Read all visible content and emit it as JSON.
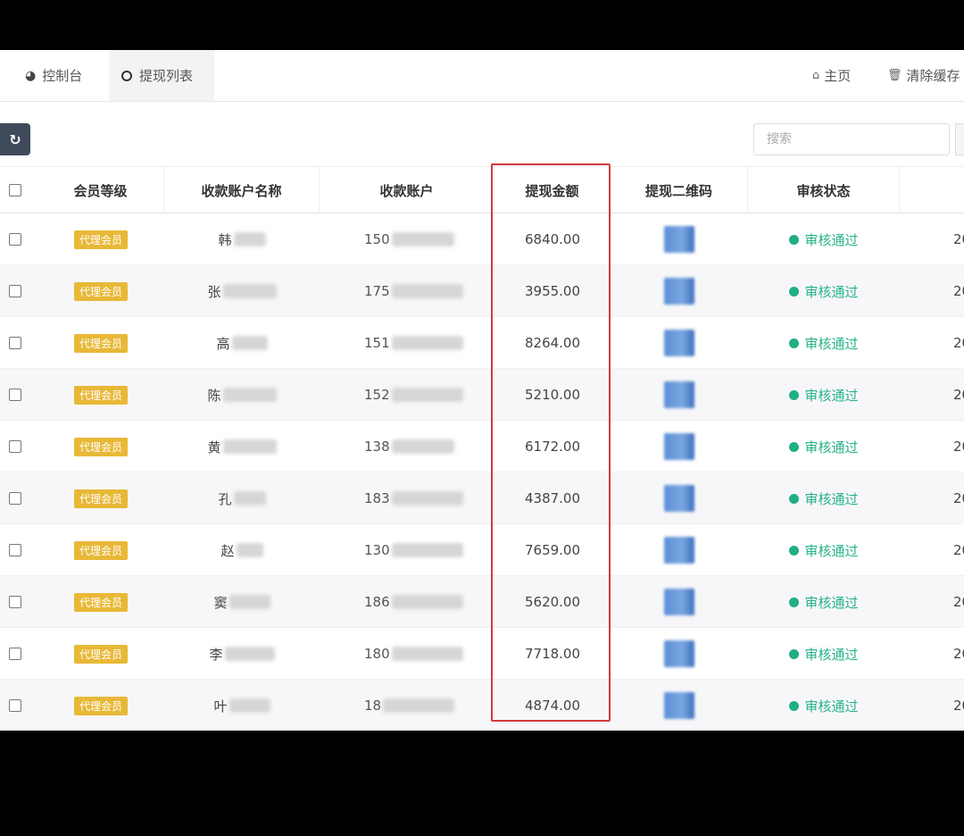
{
  "tabs": {
    "dashboard": "控制台",
    "withdraw_list": "提现列表"
  },
  "nav": {
    "home": "主页",
    "clear_cache": "清除缓存"
  },
  "toolbar": {
    "search_placeholder": "搜索"
  },
  "table": {
    "columns": [
      "会员等级",
      "收款账户名称",
      "收款账户",
      "提现金额",
      "提现二维码",
      "审核状态"
    ],
    "rows": [
      {
        "level": "代理会员",
        "name": "韩",
        "account": "150",
        "amount": "6840.00",
        "status": "审核通过",
        "date": "20"
      },
      {
        "level": "代理会员",
        "name": "张",
        "account": "175",
        "amount": "3955.00",
        "status": "审核通过",
        "date": "20"
      },
      {
        "level": "代理会员",
        "name": "高",
        "account": "151",
        "amount": "8264.00",
        "status": "审核通过",
        "date": "20"
      },
      {
        "level": "代理会员",
        "name": "陈",
        "account": "152",
        "amount": "5210.00",
        "status": "审核通过",
        "date": "20"
      },
      {
        "level": "代理会员",
        "name": "黄",
        "account": "138",
        "amount": "6172.00",
        "status": "审核通过",
        "date": "20"
      },
      {
        "level": "代理会员",
        "name": "孔",
        "account": "183",
        "amount": "4387.00",
        "status": "审核通过",
        "date": "20"
      },
      {
        "level": "代理会员",
        "name": "赵",
        "account": "130",
        "amount": "7659.00",
        "status": "审核通过",
        "date": "20"
      },
      {
        "level": "代理会员",
        "name": "窦",
        "account": "186",
        "amount": "5620.00",
        "status": "审核通过",
        "date": "20"
      },
      {
        "level": "代理会员",
        "name": "李",
        "account": "180",
        "amount": "7718.00",
        "status": "审核通过",
        "date": "20"
      },
      {
        "level": "代理会员",
        "name": "叶",
        "account": "18",
        "amount": "4874.00",
        "status": "审核通过",
        "date": "20"
      }
    ]
  },
  "colors": {
    "badge": "#e8b837",
    "status_green": "#1fae86",
    "highlight_red": "#d23b3b",
    "refresh_button": "#3f4a5a"
  },
  "icons": {
    "dashboard": "dashboard-icon",
    "withdraw": "circle-icon",
    "home": "home-icon",
    "clear_cache": "trash-icon",
    "refresh": "refresh-icon"
  }
}
